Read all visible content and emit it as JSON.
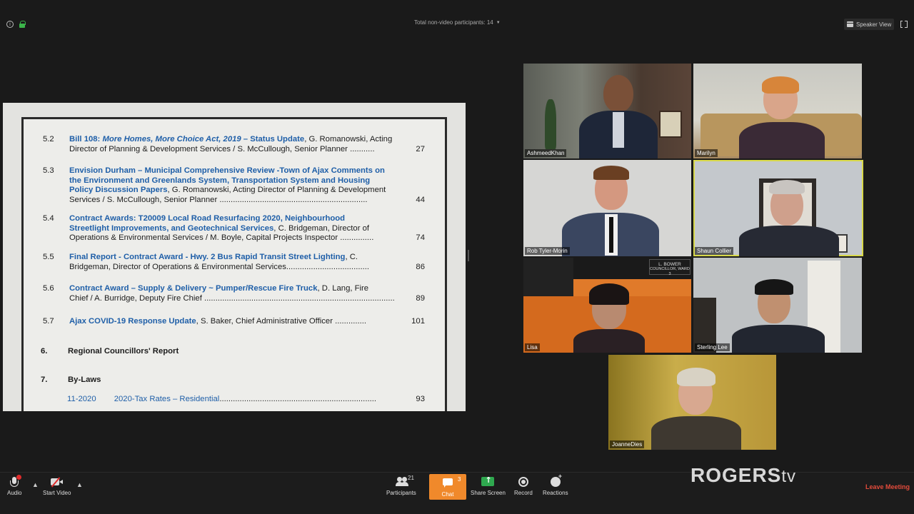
{
  "top": {
    "non_video_label": "Total non-video participants: 14",
    "speaker_view_label": "Speaker View"
  },
  "document": {
    "items": [
      {
        "num": "5.2",
        "title_a": "Bill 108: ",
        "title_italic": "More Homes, More Choice Act, 2019",
        "title_b": " – Status Update",
        "line1_rest": ", G. Romanowski, Acting",
        "line2": "Director of Planning & Development Services / S. McCullough, Senior Planner",
        "page": "27"
      },
      {
        "num": "5.3",
        "line1": "Envision Durham – Municipal Comprehensive Review -Town of Ajax Comments on",
        "line2": "the Environment and Greenlands System, Transportation System and Housing",
        "line3_blue": "Policy Discussion Papers",
        "line3_rest": ", G. Romanowski, Acting Director of Planning & Development",
        "line4": "Services / S. McCullough, Senior Planner",
        "page": "44"
      },
      {
        "num": "5.4",
        "line1": "Contract Awards: T20009 Local Road Resurfacing 2020, Neighbourhood",
        "line2_blue": "Streetlight Improvements, and Geotechnical Services",
        "line2_rest": ", C. Bridgeman, Director of",
        "line3": "Operations & Environmental Services / M. Boyle, Capital Projects Inspector",
        "page": "74"
      },
      {
        "num": "5.5",
        "line1_blue": "Final Report - Contract Award - Hwy. 2 Bus Rapid Transit Street Lighting",
        "line1_rest": ", C.",
        "line2": "Bridgeman, Director of Operations & Environmental Services",
        "page": "86"
      },
      {
        "num": "5.6",
        "line1_blue": "Contract Award – Supply & Delivery ~ Pumper/Rescue Fire Truck",
        "line1_rest": ", D. Lang, Fire",
        "line2": "Chief / A. Burridge, Deputy Fire Chief",
        "page": "89"
      },
      {
        "num": "5.7",
        "line1_blue": "Ajax COVID-19 Response Update",
        "line1_rest": ", S. Baker, Chief Administrative Officer",
        "page": "101"
      }
    ],
    "section6": {
      "num": "6.",
      "title": "Regional Councillors' Report"
    },
    "section7": {
      "num": "7.",
      "title": "By-Laws"
    },
    "bylaw": {
      "num": "11-2020",
      "title": "2020-Tax Rates – Residential",
      "page": "93"
    },
    "dots": "......................................................................................................................."
  },
  "participants": [
    {
      "name": "AshmeedKhan"
    },
    {
      "name": "Marilyn"
    },
    {
      "name": "Rob Tyler-Morin"
    },
    {
      "name": "Shaun Collier"
    },
    {
      "name": "Lisa"
    },
    {
      "name": "Sterling Lee"
    },
    {
      "name": "JoanneDies"
    }
  ],
  "nameplate": {
    "line1": "L. BOWER",
    "line2": "COUNCILLOR, WARD 3"
  },
  "toolbar": {
    "audio_label": "Audio",
    "video_label": "Start Video",
    "participants_label": "Participants",
    "participants_count": "21",
    "chat_label": "Chat",
    "chat_count": "3",
    "share_label": "Share Screen",
    "record_label": "Record",
    "reactions_label": "Reactions",
    "leave_label": "Leave Meeting"
  },
  "watermark": {
    "brand": "ROGERS",
    "suffix": "tv"
  },
  "colors": {
    "link_blue": "#1f5fa8",
    "chat_orange": "#f0892b",
    "share_green": "#2fa84f",
    "leave_red": "#e44b3b",
    "active_speaker": "#d8d84a"
  }
}
